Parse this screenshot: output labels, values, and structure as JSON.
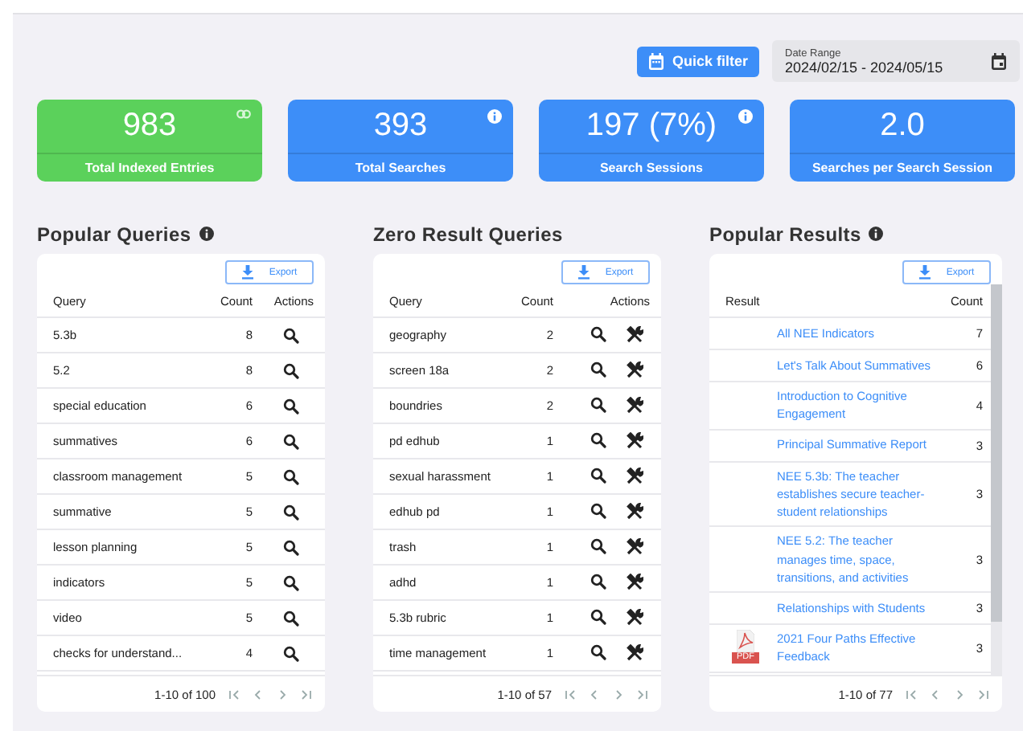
{
  "toolbar": {
    "quick_filter": "Quick filter",
    "date_range": {
      "label": "Date Range",
      "value": "2024/02/15 - 2024/05/15"
    }
  },
  "stats": [
    {
      "value": "983",
      "label": "Total Indexed Entries",
      "color": "#5bd15b",
      "kind": "link"
    },
    {
      "value": "393",
      "label": "Total Searches",
      "color": "#3d8ef8",
      "kind": "info"
    },
    {
      "value": "197 (7%)",
      "label": "Search Sessions",
      "color": "#3d8ef8",
      "kind": "info"
    },
    {
      "value": "2.0",
      "label": "Searches per Search Session",
      "color": "#3d8ef8",
      "kind": "plain"
    }
  ],
  "panels": [
    {
      "kind": "queries",
      "title": "Popular Queries",
      "info": true,
      "export": "Export",
      "columns": [
        "Query",
        "Count",
        "Actions"
      ],
      "pagination": "1-10 of 100",
      "rows": [
        {
          "text": "5.3b",
          "count": "8"
        },
        {
          "text": "5.2",
          "count": "8"
        },
        {
          "text": "special education",
          "count": "6"
        },
        {
          "text": "summatives",
          "count": "6"
        },
        {
          "text": "classroom management",
          "count": "5"
        },
        {
          "text": "summative",
          "count": "5"
        },
        {
          "text": "lesson planning",
          "count": "5"
        },
        {
          "text": "indicators",
          "count": "5"
        },
        {
          "text": "video",
          "count": "5"
        },
        {
          "text": "checks for understand...",
          "count": "4"
        }
      ]
    },
    {
      "kind": "zero",
      "title": "Zero Result Queries",
      "info": false,
      "export": "Export",
      "columns": [
        "Query",
        "Count",
        "Actions"
      ],
      "pagination": "1-10 of 57",
      "rows": [
        {
          "text": "geography",
          "count": "2"
        },
        {
          "text": "screen 18a",
          "count": "2"
        },
        {
          "text": "boundries",
          "count": "2"
        },
        {
          "text": "pd edhub",
          "count": "1"
        },
        {
          "text": "sexual harassment",
          "count": "1"
        },
        {
          "text": "edhub pd",
          "count": "1"
        },
        {
          "text": "trash",
          "count": "1"
        },
        {
          "text": "adhd",
          "count": "1"
        },
        {
          "text": "5.3b rubric",
          "count": "1"
        },
        {
          "text": "time management",
          "count": "1"
        }
      ]
    },
    {
      "kind": "results",
      "title": "Popular Results",
      "info": true,
      "export": "Export",
      "columns": [
        "Result",
        "Count"
      ],
      "pagination": "1-10 of 77",
      "rows": [
        {
          "text": "All NEE Indicators",
          "count": "7"
        },
        {
          "text": "Let's Talk About Summatives",
          "count": "6"
        },
        {
          "text": "Introduction to Cognitive Engagement",
          "count": "4"
        },
        {
          "text": "Principal Summative Report",
          "count": "3"
        },
        {
          "text": "NEE 5.3b: The teacher establishes secure teacher-student relationships",
          "count": "3"
        },
        {
          "text": "NEE 5.2: The teacher manages time, space, transitions, and activities",
          "count": "3"
        },
        {
          "text": "Relationships with Students",
          "count": "3"
        },
        {
          "text": "2021 Four Paths Effective Feedback",
          "count": "3",
          "file": "PDF"
        }
      ]
    }
  ]
}
